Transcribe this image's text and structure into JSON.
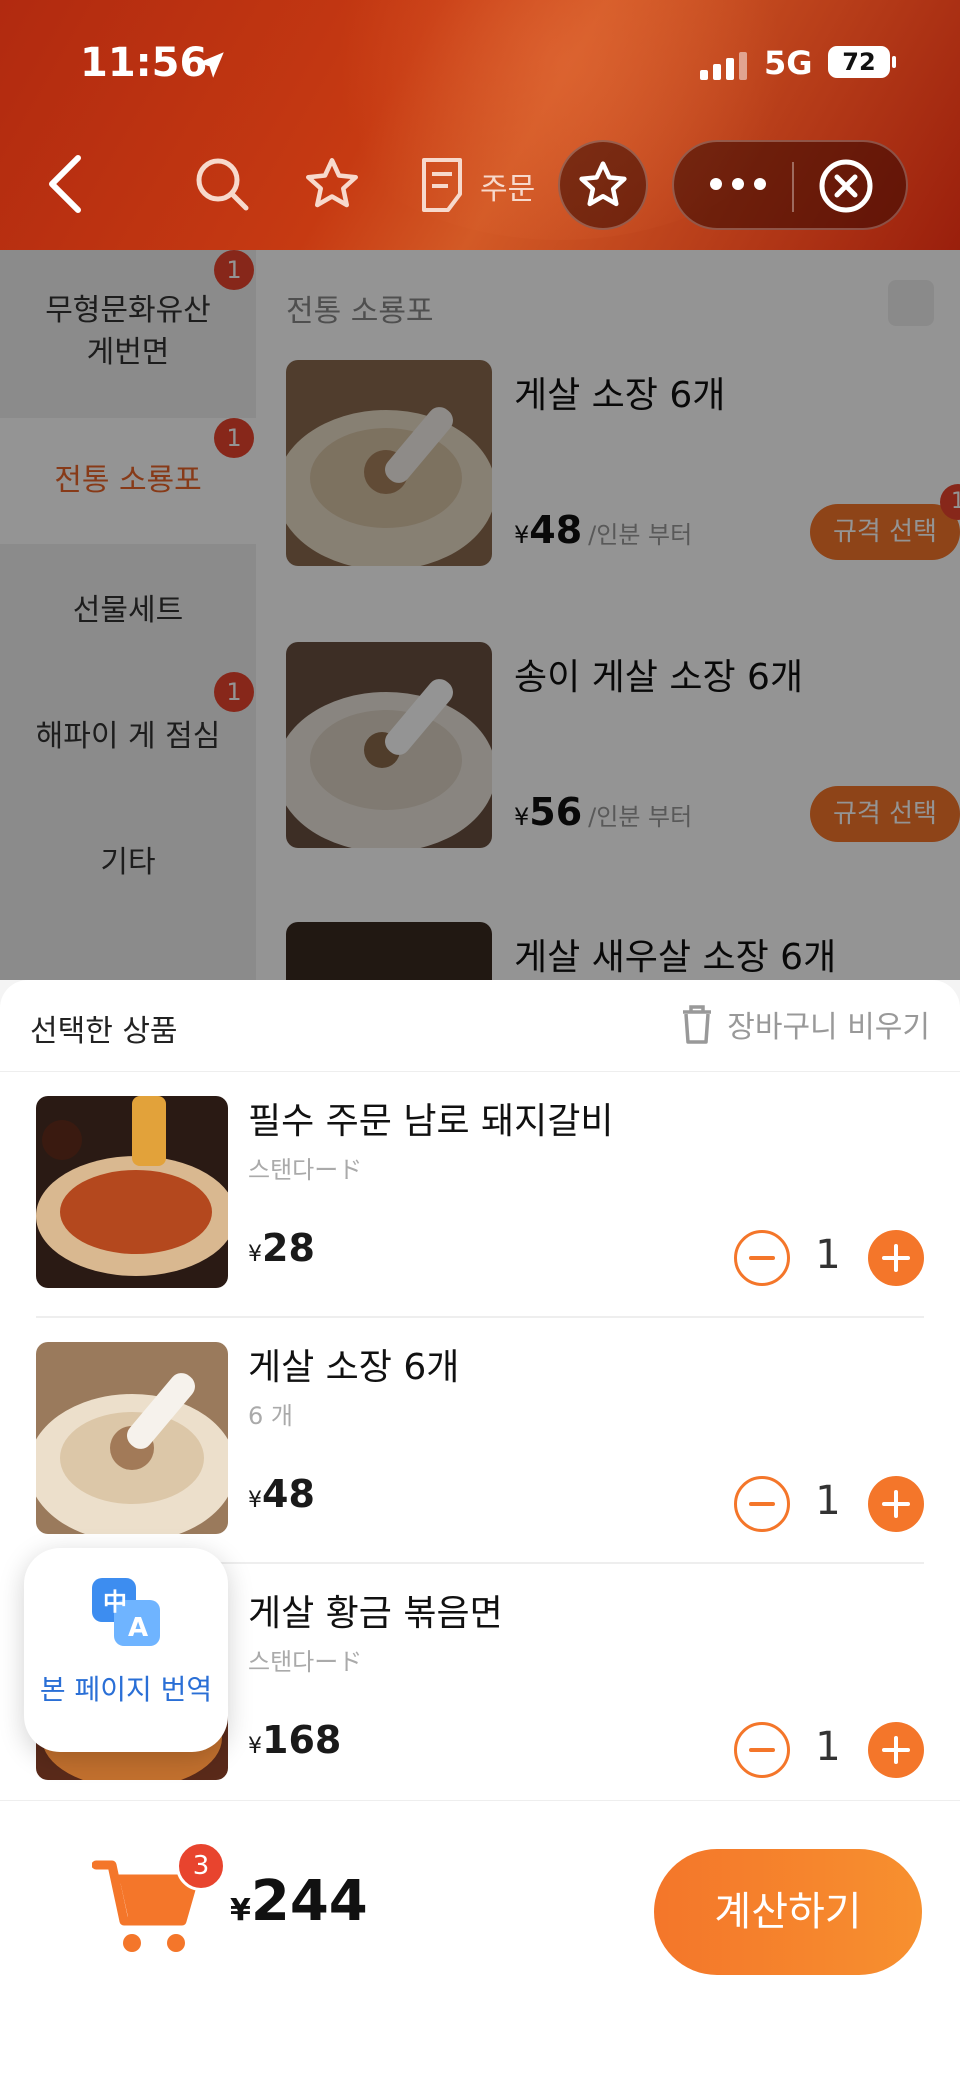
{
  "status_bar": {
    "time": "11:56",
    "network": "5G",
    "battery": "72"
  },
  "nav": {
    "order_label": "주문"
  },
  "sidebar": {
    "items": [
      {
        "label": "무형문화유산\n게번면",
        "badge": "1"
      },
      {
        "label": "전통 소룡포",
        "badge": "1"
      },
      {
        "label": "선물세트",
        "badge": ""
      },
      {
        "label": "해파이 게 점심",
        "badge": "1"
      },
      {
        "label": "기타",
        "badge": ""
      }
    ]
  },
  "menu": {
    "section_title": "전통 소룡포",
    "products": [
      {
        "name": "게살 소장 6개",
        "currency": "¥",
        "price": "48",
        "unit": "/인분 부터",
        "select_label": "규격 선택",
        "badge": "1"
      },
      {
        "name": "송이 게살 소장 6개",
        "currency": "¥",
        "price": "56",
        "unit": "/인분 부터",
        "select_label": "규격 선택"
      },
      {
        "name": "게살 새우살 소장 6개"
      }
    ]
  },
  "cart_sheet": {
    "title": "선택한 상품",
    "clear_label": "장바구니 비우기",
    "items": [
      {
        "name": "필수 주문 남로 돼지갈비",
        "spec": "스탠다ード",
        "currency": "¥",
        "price": "28",
        "qty": "1"
      },
      {
        "name": "게살 소장 6개",
        "spec": "6 개",
        "currency": "¥",
        "price": "48",
        "qty": "1"
      },
      {
        "name": "게살 황금 볶음면",
        "spec": "스탠다ード",
        "currency": "¥",
        "price": "168",
        "qty": "1"
      }
    ]
  },
  "translate": {
    "label": "본 페이지 번역"
  },
  "bottom_bar": {
    "cart_count": "3",
    "currency": "¥",
    "total": "244",
    "checkout_label": "계산하기"
  },
  "colors": {
    "accent": "#f4762a",
    "badge": "#e8442e",
    "header": "#b12a10"
  }
}
